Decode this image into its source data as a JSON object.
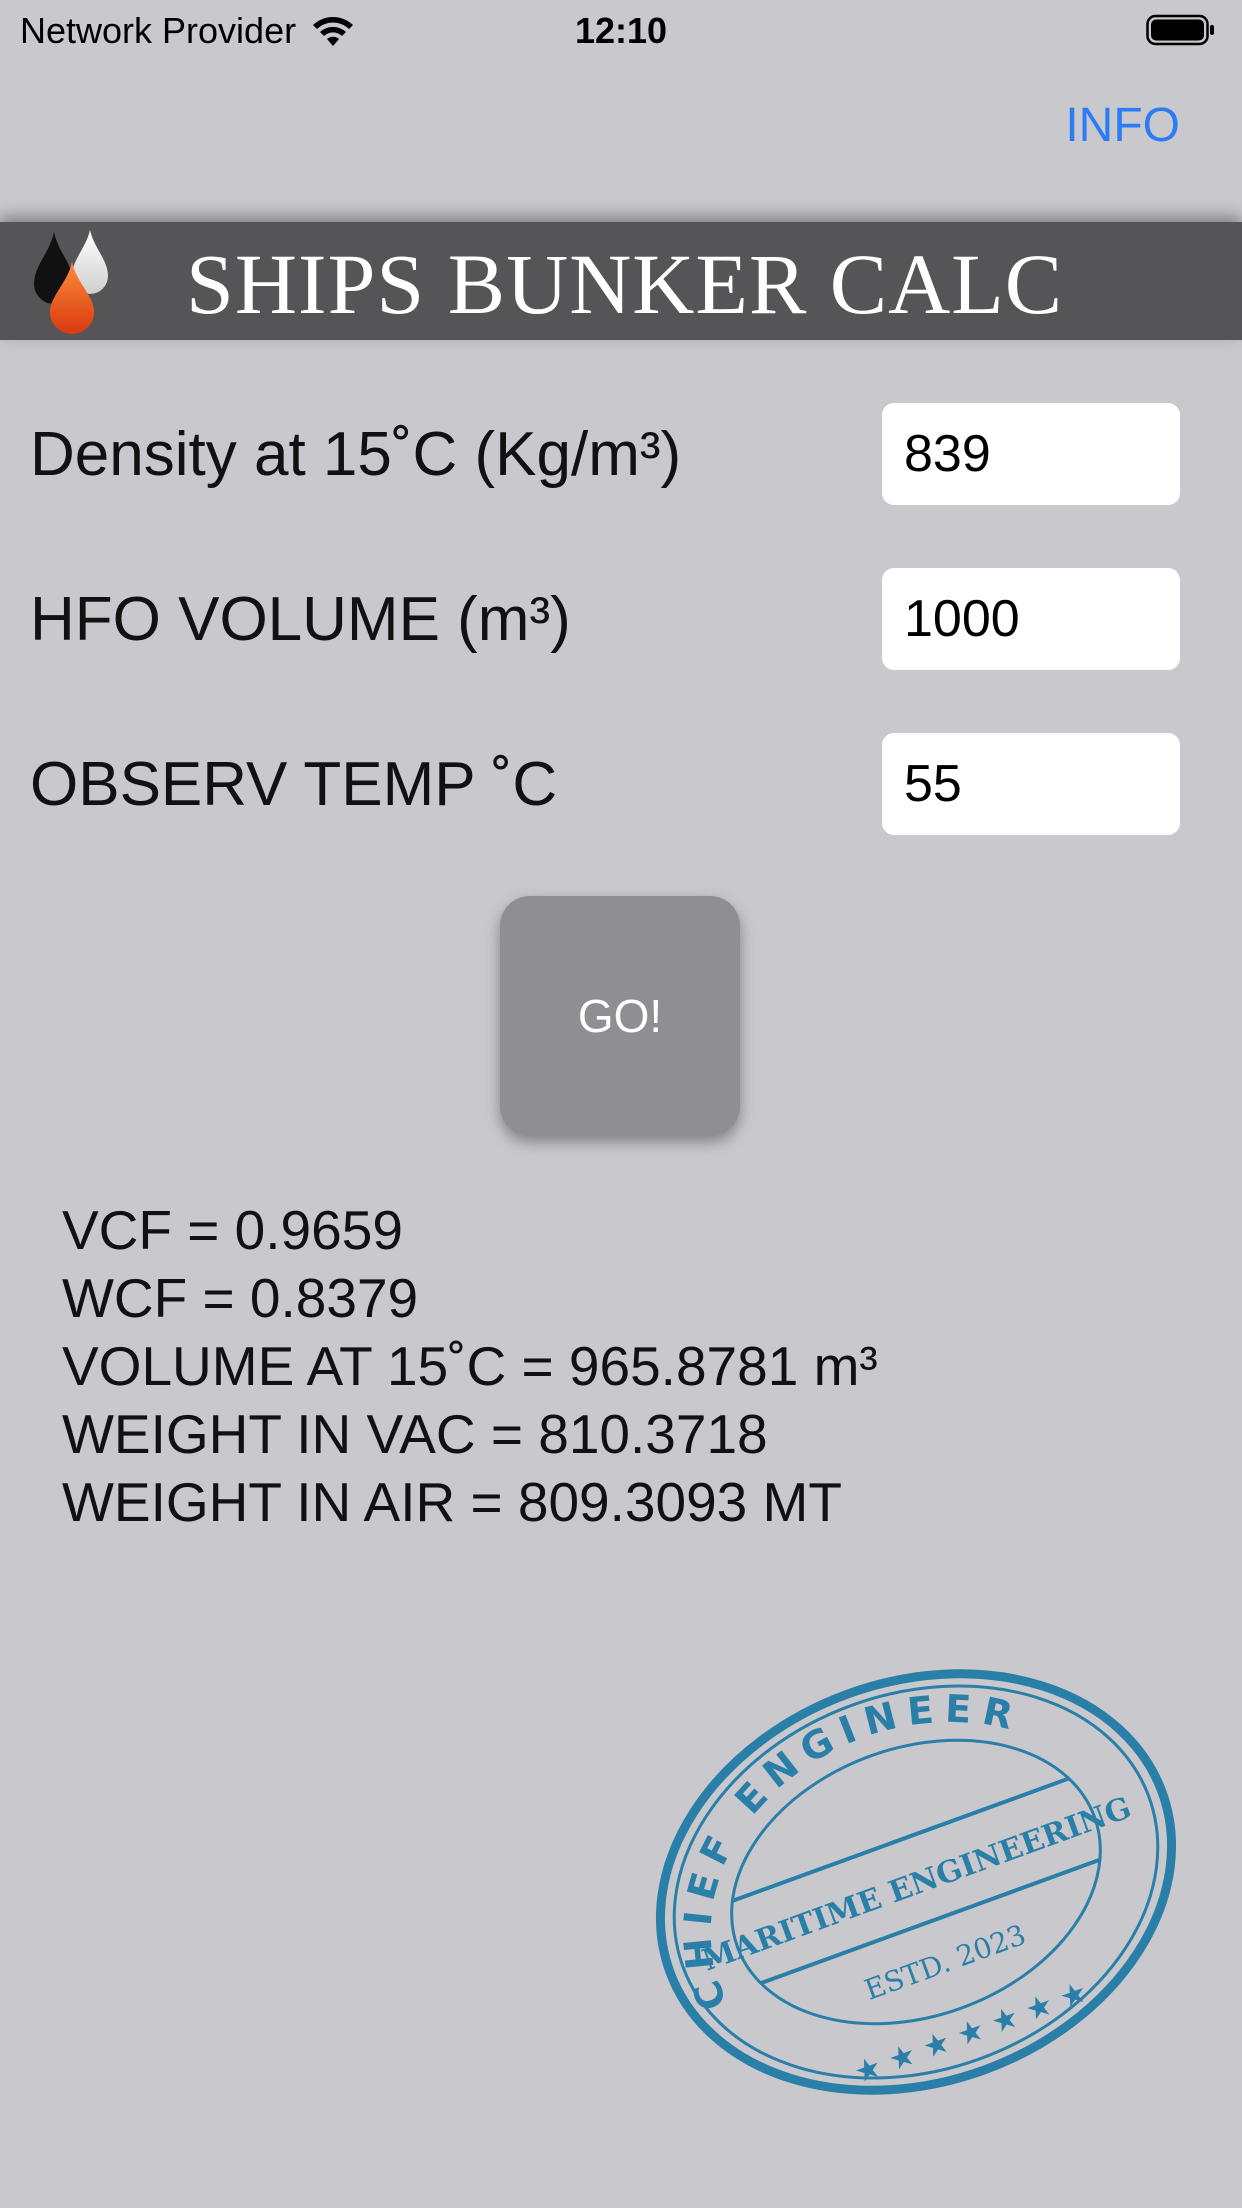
{
  "status_bar": {
    "carrier": "Network Provider",
    "time": "12:10"
  },
  "nav": {
    "info_label": "INFO",
    "accent_color": "#2d7cf6"
  },
  "header": {
    "title": "SHIPS BUNKER CALC",
    "logo_icon": "oil-drops-icon",
    "background": "#555557"
  },
  "form": {
    "density": {
      "label": "Density at 15˚C (Kg/m³)",
      "value": "839"
    },
    "volume": {
      "label": "HFO VOLUME (m³)",
      "value": "1000"
    },
    "temp": {
      "label": "OBSERV TEMP ˚C",
      "value": "55"
    }
  },
  "go_button": {
    "label": "GO!",
    "color": "#8e8e93"
  },
  "results": [
    "VCF = 0.9659",
    "WCF = 0.8379",
    "VOLUME AT 15˚C = 965.8781 m³",
    "WEIGHT IN VAC = 810.3718",
    "WEIGHT IN AIR = 809.3093 MT"
  ],
  "stamp": {
    "top_text": "CHIEF ENGINEER",
    "middle_text": "MARITIME ENGINEERING",
    "bottom_text": "ESTD. 2023",
    "color": "#2a7fa8"
  }
}
